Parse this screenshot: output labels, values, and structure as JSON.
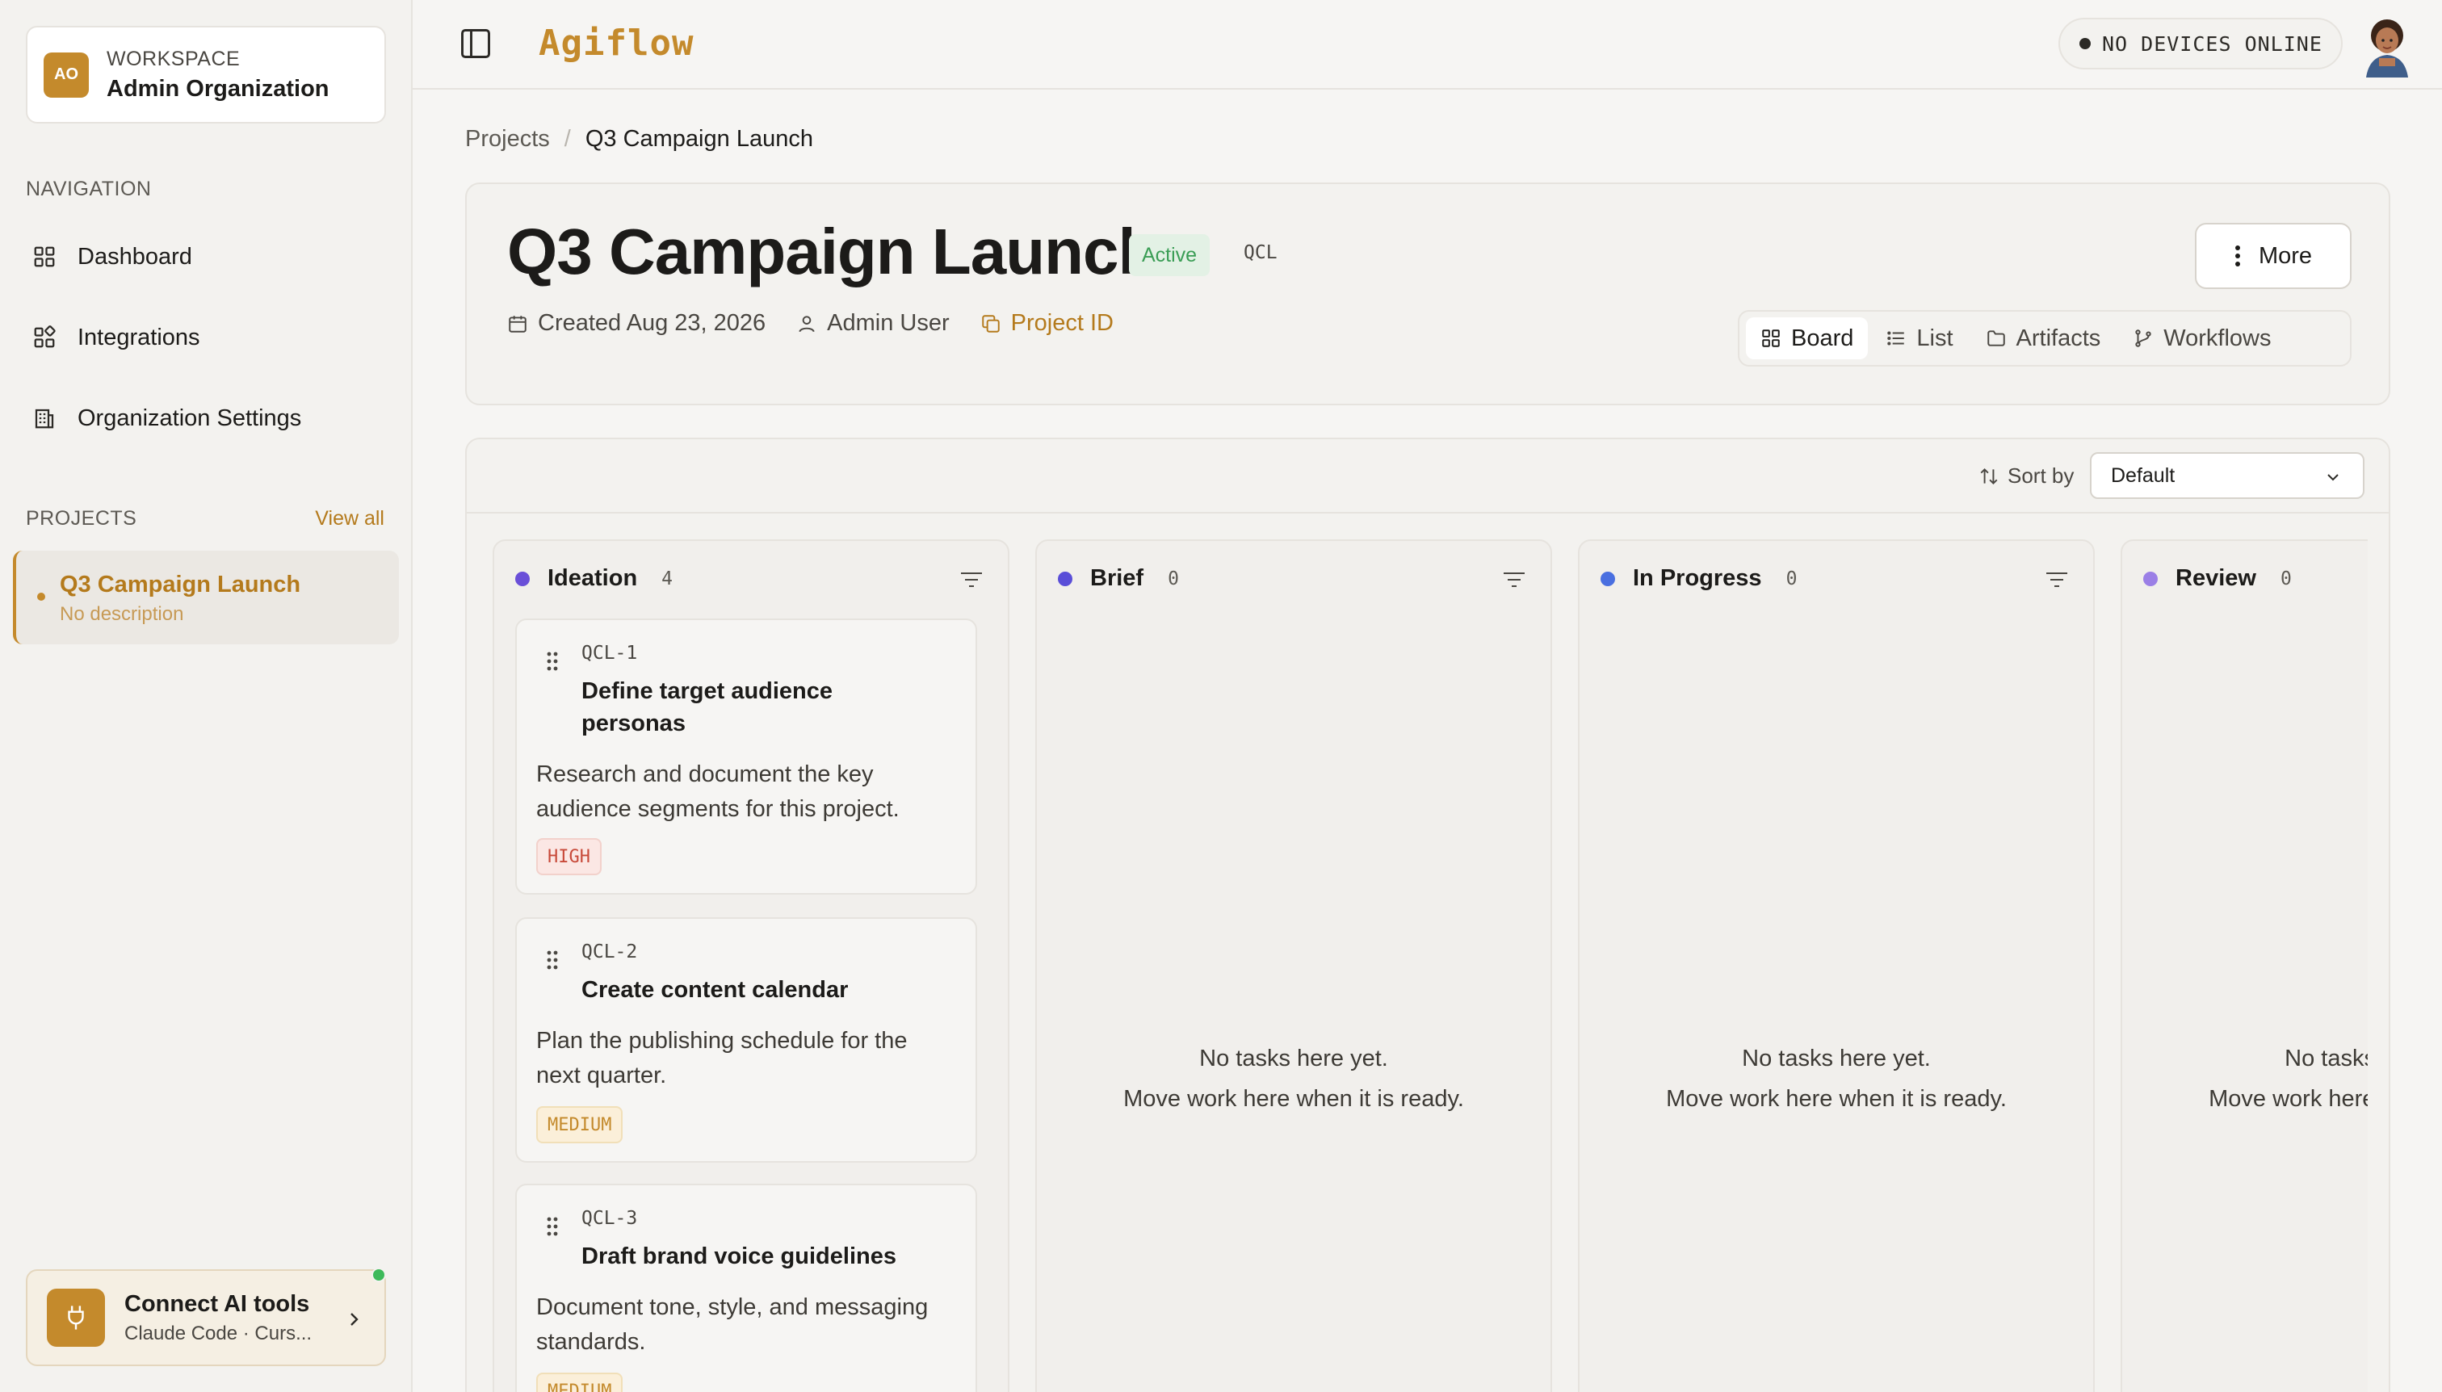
{
  "workspace": {
    "initials": "AO",
    "label": "WORKSPACE",
    "name": "Admin Organization"
  },
  "nav": {
    "label": "NAVIGATION",
    "items": [
      {
        "label": "Dashboard",
        "icon": "grid-icon"
      },
      {
        "label": "Integrations",
        "icon": "integrations-icon"
      },
      {
        "label": "Organization Settings",
        "icon": "building-icon"
      }
    ]
  },
  "projects": {
    "label": "PROJECTS",
    "view_all": "View all",
    "items": [
      {
        "title": "Q3 Campaign Launch",
        "description": "No description"
      }
    ]
  },
  "connect": {
    "title": "Connect AI tools",
    "subtitle": "Claude Code · Curs..."
  },
  "topbar": {
    "logo": "Agiflow",
    "devices": "NO DEVICES ONLINE"
  },
  "breadcrumb": {
    "root": "Projects",
    "separator": "/",
    "current": "Q3 Campaign Launch"
  },
  "project": {
    "title": "Q3 Campaign Launch",
    "status": "Active",
    "key": "QCL",
    "created": "Created Aug 23, 2026",
    "owner": "Admin User",
    "project_id_label": "Project ID",
    "more_label": "More",
    "tabs": [
      {
        "label": "Board",
        "icon": "board-icon",
        "active": true
      },
      {
        "label": "List",
        "icon": "list-icon",
        "active": false
      },
      {
        "label": "Artifacts",
        "icon": "folder-icon",
        "active": false
      },
      {
        "label": "Workflows",
        "icon": "workflow-icon",
        "active": false
      }
    ]
  },
  "board": {
    "sort_label": "Sort by",
    "sort_value": "Default",
    "columns": [
      {
        "title": "Ideation",
        "count": "4",
        "color": "#6a4fd8",
        "tasks": [
          {
            "key": "QCL-1",
            "title": "Define target audience personas",
            "description": "Research and document the key audience segments for this project.",
            "priority": "HIGH"
          },
          {
            "key": "QCL-2",
            "title": "Create content calendar",
            "description": "Plan the publishing schedule for the next quarter.",
            "priority": "MEDIUM"
          },
          {
            "key": "QCL-3",
            "title": "Draft brand voice guidelines",
            "description": "Document tone, style, and messaging standards.",
            "priority": "MEDIUM"
          }
        ]
      },
      {
        "title": "Brief",
        "count": "0",
        "color": "#5a4ed8",
        "empty_line1": "No tasks here yet.",
        "empty_line2": "Move work here when it is ready."
      },
      {
        "title": "In Progress",
        "count": "0",
        "color": "#4a6fe0",
        "empty_line1": "No tasks here yet.",
        "empty_line2": "Move work here when it is ready."
      },
      {
        "title": "Review",
        "count": "0",
        "color": "#9b7fe6",
        "empty_line1": "No tasks here yet.",
        "empty_line2": "Move work here when it is ready."
      }
    ]
  },
  "colors": {
    "accent": "#c48a2c",
    "active_green": "#3a9d55",
    "high": "#c84a3a"
  }
}
